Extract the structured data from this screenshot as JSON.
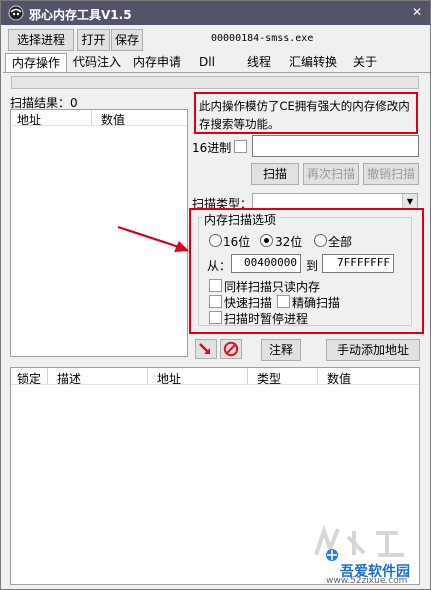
{
  "window": {
    "title": "邪心内存工具V1.5",
    "close_glyph": "✕"
  },
  "toolbar": {
    "select_process": "选择进程",
    "open": "打开",
    "save": "保存",
    "process_name": "00000184-smss.exe"
  },
  "tabs": [
    {
      "label": "内存操作",
      "active": true
    },
    {
      "label": "代码注入"
    },
    {
      "label": "内存申请"
    },
    {
      "label": "Dll"
    },
    {
      "label": "线程"
    },
    {
      "label": "汇编转换"
    },
    {
      "label": "关于"
    }
  ],
  "progress": {
    "value": 0
  },
  "results": {
    "label": "扫描结果：0",
    "columns": [
      "地址",
      "数值"
    ]
  },
  "note": "此内操作模仿了CE拥有强大的内存修改内存搜索等功能。",
  "hex": {
    "label": "16进制",
    "checked": false,
    "value": ""
  },
  "scan_buttons": {
    "scan": "扫描",
    "rescan": "再次扫描",
    "undo": "撤销扫描"
  },
  "scan_type": {
    "label": "扫描类型：",
    "value": ""
  },
  "options": {
    "group_title": "内存扫描选项",
    "bits": [
      {
        "label": "16位",
        "selected": false
      },
      {
        "label": "32位",
        "selected": true
      },
      {
        "label": "全部",
        "selected": false
      }
    ],
    "from_label": "从：",
    "from_value": "00400000",
    "to_label": "到",
    "to_value": "7FFFFFFF",
    "checks": [
      {
        "label": "同样扫描只读内存",
        "checked": false
      },
      {
        "label": "快速扫描",
        "checked": false
      },
      {
        "label": "精确扫描",
        "checked": false
      },
      {
        "label": "扫描时暂停进程",
        "checked": false
      }
    ]
  },
  "actions": {
    "arrow_icon": "arrow-icon",
    "clear_icon": "no-entry-icon",
    "comment": "注释",
    "manual_add": "手动添加地址"
  },
  "address_table": {
    "columns": [
      "锁定",
      "描述",
      "地址",
      "类型",
      "数值"
    ]
  },
  "colors": {
    "titlebar": "#53546a",
    "annotation_red": "#d9001b",
    "progress_green": "#06b025"
  },
  "watermark": {
    "brand": "吾爱软件园",
    "url": "www.52zixue.com"
  }
}
